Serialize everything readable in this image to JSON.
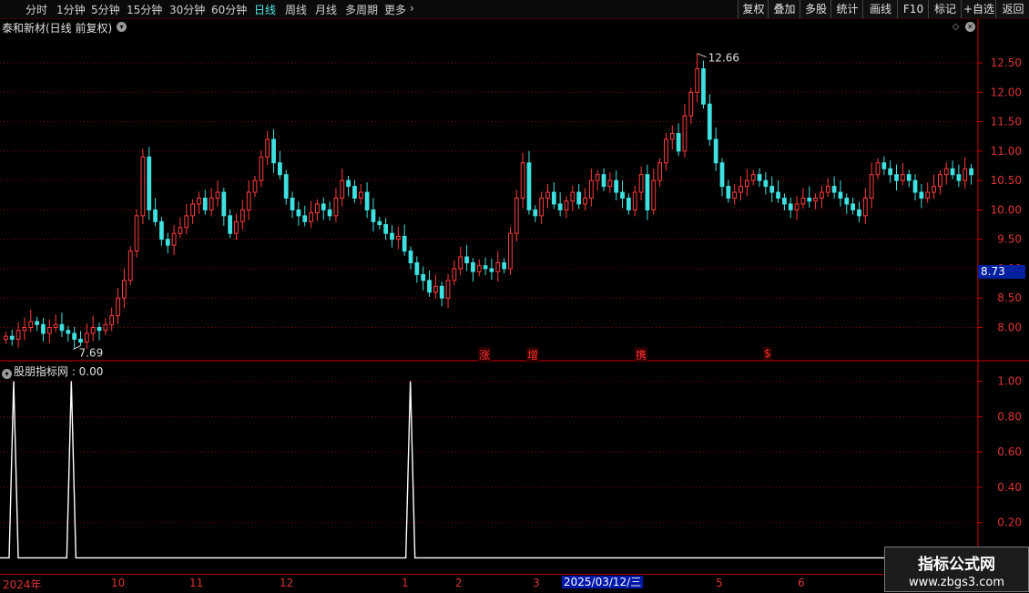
{
  "toolbar": {
    "periods": [
      "分时",
      "1分钟",
      "5分钟",
      "15分钟",
      "30分钟",
      "60分钟",
      "日线",
      "周线",
      "月线",
      "多周期",
      "更多"
    ],
    "active_period": "日线",
    "right_buttons": [
      "复权",
      "叠加",
      "多股",
      "统计",
      "画线",
      "F10",
      "标记",
      "+自选",
      "返回"
    ]
  },
  "stock": {
    "title": "泰和新材(日线 前复权)",
    "current_price_tag": "8.73",
    "high_label": "12.66",
    "low_label": "7.69"
  },
  "indicator": {
    "title": "股朋指标网 : 0.00"
  },
  "signals": [
    "涨",
    "增",
    "携",
    "$"
  ],
  "date_axis": {
    "labels": [
      "2024年",
      "10",
      "11",
      "12",
      "1",
      "2",
      "3",
      "5",
      "6"
    ],
    "highlighted": "2025/03/12/三"
  },
  "watermark": {
    "line1": "指标公式网",
    "line2": "www.zbgs3.com"
  },
  "colors": {
    "up": "#ff3b3b",
    "down": "#3fe0e0",
    "grid": "#8a0000",
    "axis": "#cc0000"
  },
  "chart_data": [
    {
      "type": "candlestick",
      "title": "泰和新材(日线 前复权)",
      "y_ticks": [
        8.0,
        8.5,
        9.0,
        9.5,
        10.0,
        10.5,
        11.0,
        11.5,
        12.0,
        12.5
      ],
      "ylim": [
        7.45,
        12.95
      ],
      "high_annotation": 12.66,
      "low_annotation": 7.69,
      "grid": true,
      "closes": [
        7.85,
        7.8,
        7.95,
        8.0,
        8.1,
        8.05,
        7.9,
        8.0,
        8.05,
        7.95,
        7.9,
        7.8,
        7.75,
        7.9,
        8.0,
        7.95,
        8.05,
        8.2,
        8.5,
        8.8,
        9.3,
        9.9,
        10.9,
        10.0,
        9.8,
        9.5,
        9.4,
        9.6,
        9.7,
        9.9,
        10.1,
        10.2,
        10.0,
        10.2,
        10.3,
        9.9,
        9.6,
        9.8,
        10.0,
        10.3,
        10.5,
        10.9,
        11.2,
        10.8,
        10.6,
        10.2,
        10.0,
        9.9,
        9.8,
        9.95,
        10.1,
        10.0,
        9.9,
        10.2,
        10.5,
        10.4,
        10.2,
        10.3,
        10.0,
        9.8,
        9.75,
        9.6,
        9.5,
        9.55,
        9.3,
        9.1,
        8.9,
        8.8,
        8.6,
        8.7,
        8.5,
        8.8,
        9.0,
        9.2,
        9.1,
        8.95,
        9.05,
        9.0,
        8.95,
        9.1,
        9.0,
        9.6,
        10.2,
        10.8,
        10.0,
        9.9,
        10.2,
        10.3,
        10.1,
        10.0,
        10.15,
        10.3,
        10.1,
        10.2,
        10.5,
        10.6,
        10.4,
        10.5,
        10.3,
        10.2,
        10.0,
        10.3,
        10.6,
        10.0,
        10.5,
        10.8,
        11.2,
        11.3,
        11.0,
        11.6,
        12.0,
        12.4,
        11.8,
        11.2,
        10.8,
        10.4,
        10.2,
        10.3,
        10.4,
        10.5,
        10.6,
        10.5,
        10.4,
        10.3,
        10.2,
        10.1,
        10.0,
        10.1,
        10.2,
        10.15,
        10.2,
        10.3,
        10.4,
        10.3,
        10.2,
        10.1,
        10.0,
        9.9,
        10.2,
        10.6,
        10.8,
        10.7,
        10.6,
        10.5,
        10.6,
        10.5,
        10.3,
        10.2,
        10.3,
        10.4,
        10.6,
        10.7,
        10.6,
        10.5,
        10.7,
        10.6
      ]
    },
    {
      "type": "line",
      "title": "股朋指标网",
      "y_ticks": [
        0.2,
        0.4,
        0.6,
        0.8,
        1.0
      ],
      "ylim": [
        -0.08,
        1.07
      ],
      "spikes_at_fraction": [
        0.014,
        0.073,
        0.42
      ],
      "value": 0.0
    }
  ]
}
